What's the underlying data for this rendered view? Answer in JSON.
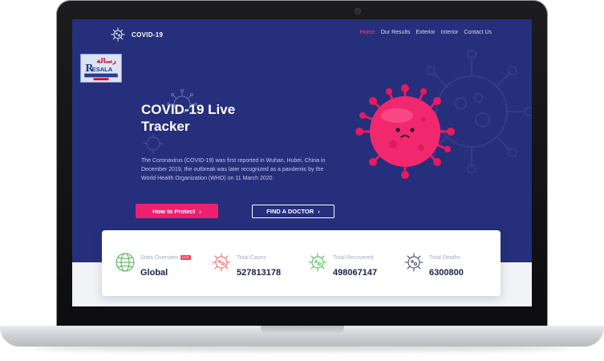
{
  "nav": {
    "brand": "COVID-19",
    "items": [
      {
        "label": "Home",
        "active": true
      },
      {
        "label": "Our Results",
        "active": false
      },
      {
        "label": "Exterior",
        "active": false
      },
      {
        "label": "Interior",
        "active": false
      },
      {
        "label": "Contact Us",
        "active": false
      }
    ]
  },
  "logo": {
    "text_ar": "رسالة",
    "text_en": "RESALA",
    "icon": "resala-logo"
  },
  "hero": {
    "title_line1": "COVID-19 Live",
    "title_line2": "Tracker",
    "description": "The Coronavirus (COVID-19) was first reported in Wuhan, Hubei, China in December 2019, the outbreak was later recognized as a pandemic by the World Health Organization (WHO) on 11 March 2020.",
    "primary_button": "How to Protect",
    "secondary_button": "FIND A DOCTOR"
  },
  "stats": {
    "overview": {
      "label": "Stats Overview",
      "badge": "LIVE",
      "value": "Global",
      "icon": "globe-icon"
    },
    "cases": {
      "label": "Total Cases",
      "value": "527813178",
      "icon": "virus-icon"
    },
    "recovered": {
      "label": "Total Recovered",
      "value": "498067147",
      "icon": "virus-icon"
    },
    "deaths": {
      "label": "Total Deaths",
      "value": "6300800",
      "icon": "virus-icon"
    }
  },
  "colors": {
    "screen_bg": "#262f7c",
    "accent": "#ef1f70",
    "cases": "#ff5a5a",
    "recovered": "#3fbf4a",
    "deaths": "#3a3f66"
  }
}
